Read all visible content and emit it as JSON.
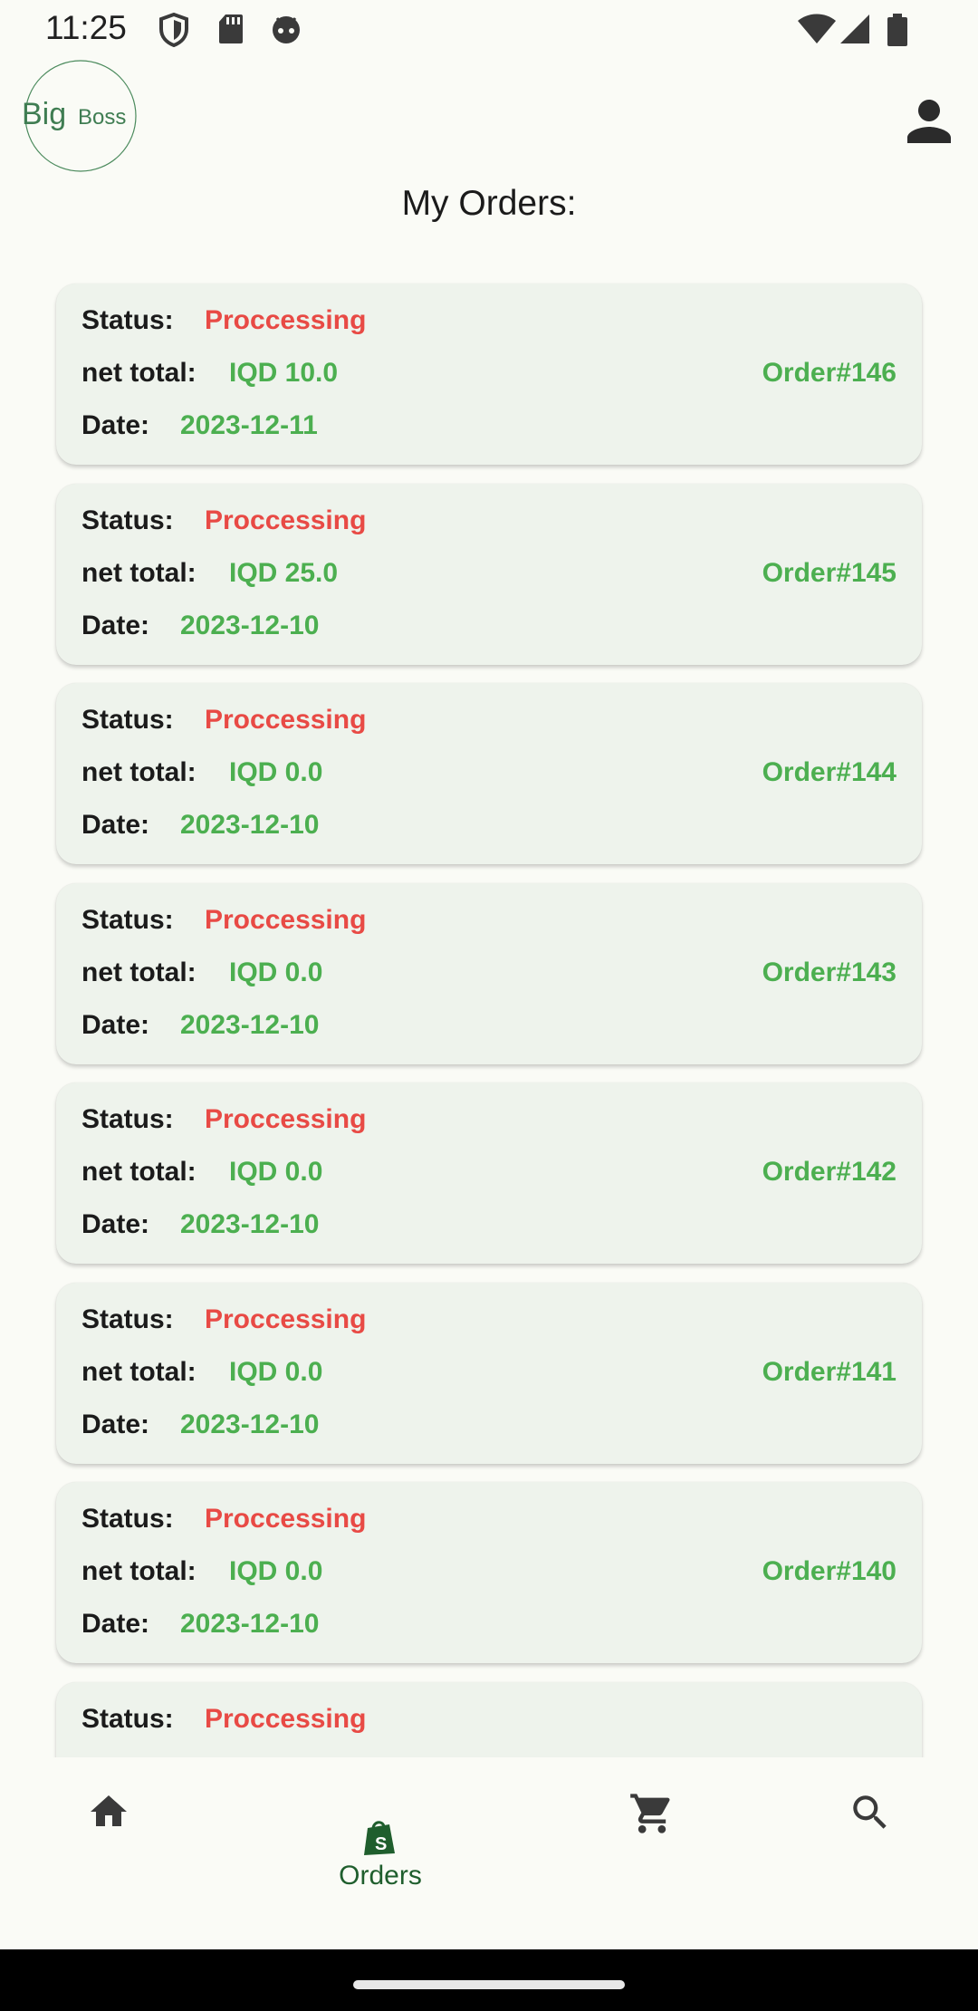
{
  "status_bar": {
    "time": "11:25",
    "left_icons": [
      "shield-icon",
      "sd-card-icon",
      "android-face-icon"
    ],
    "right_icons": [
      "wifi-icon",
      "cellular-signal-icon",
      "battery-icon"
    ]
  },
  "header": {
    "logo": {
      "word1": "Big",
      "word2": "Boss"
    },
    "profile_icon": "person-icon",
    "title": "My Orders:"
  },
  "labels": {
    "status": "Status:",
    "net_total": "net total:",
    "date": "Date:"
  },
  "orders": [
    {
      "status": "Proccessing",
      "net_total": "IQD 10.0",
      "order_no": "Order#146",
      "date": "2023-12-11"
    },
    {
      "status": "Proccessing",
      "net_total": "IQD 25.0",
      "order_no": "Order#145",
      "date": "2023-12-10"
    },
    {
      "status": "Proccessing",
      "net_total": "IQD 0.0",
      "order_no": "Order#144",
      "date": "2023-12-10"
    },
    {
      "status": "Proccessing",
      "net_total": "IQD 0.0",
      "order_no": "Order#143",
      "date": "2023-12-10"
    },
    {
      "status": "Proccessing",
      "net_total": "IQD 0.0",
      "order_no": "Order#142",
      "date": "2023-12-10"
    },
    {
      "status": "Proccessing",
      "net_total": "IQD 0.0",
      "order_no": "Order#141",
      "date": "2023-12-10"
    },
    {
      "status": "Proccessing",
      "net_total": "IQD 0.0",
      "order_no": "Order#140",
      "date": "2023-12-10"
    },
    {
      "status": "Proccessing"
    }
  ],
  "bottom_nav": {
    "items": [
      {
        "icon": "home-icon",
        "label": ""
      },
      {
        "icon": "shopping-bag-icon",
        "label": "Orders",
        "selected": true
      },
      {
        "icon": "cart-icon",
        "label": ""
      },
      {
        "icon": "search-icon",
        "label": ""
      }
    ]
  },
  "colors": {
    "status_red": "#e84a45",
    "value_green": "#4caf50",
    "nav_active": "#1f5e2d",
    "card_bg": "#eef3ec"
  }
}
